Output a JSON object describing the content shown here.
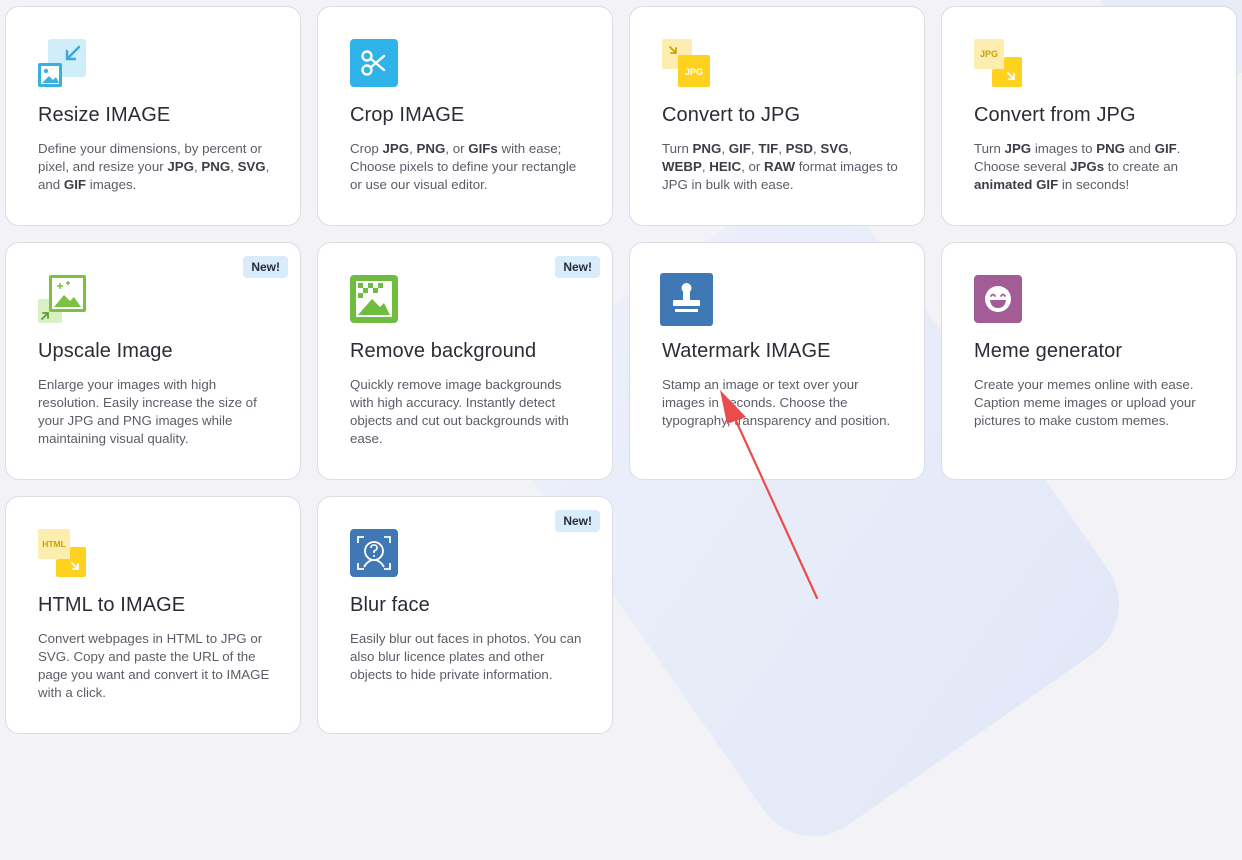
{
  "cards": [
    {
      "title": "Resize IMAGE",
      "icon": "resize-icon",
      "desc": [
        [
          "Define your dimensions, by percent or pixel, and resize your ",
          false
        ],
        [
          "JPG",
          true
        ],
        [
          ", ",
          false
        ],
        [
          "PNG",
          true
        ],
        [
          ", ",
          false
        ],
        [
          "SVG",
          true
        ],
        [
          ", and ",
          false
        ],
        [
          "GIF",
          true
        ],
        [
          " images.",
          false
        ]
      ]
    },
    {
      "title": "Crop IMAGE",
      "icon": "scissors-icon",
      "desc": [
        [
          "Crop ",
          false
        ],
        [
          "JPG",
          true
        ],
        [
          ", ",
          false
        ],
        [
          "PNG",
          true
        ],
        [
          ", or ",
          false
        ],
        [
          "GIFs",
          true
        ],
        [
          " with ease; Choose pixels to define your rectangle or use our visual editor.",
          false
        ]
      ]
    },
    {
      "title": "Convert to JPG",
      "icon": "convert-to-jpg-icon",
      "icon_text": "JPG",
      "desc": [
        [
          "Turn ",
          false
        ],
        [
          "PNG",
          true
        ],
        [
          ", ",
          false
        ],
        [
          "GIF",
          true
        ],
        [
          ", ",
          false
        ],
        [
          "TIF",
          true
        ],
        [
          ", ",
          false
        ],
        [
          "PSD",
          true
        ],
        [
          ", ",
          false
        ],
        [
          "SVG",
          true
        ],
        [
          ", ",
          false
        ],
        [
          "WEBP",
          true
        ],
        [
          ", ",
          false
        ],
        [
          "HEIC",
          true
        ],
        [
          ", or ",
          false
        ],
        [
          "RAW",
          true
        ],
        [
          " format images to JPG in bulk with ease.",
          false
        ]
      ]
    },
    {
      "title": "Convert from JPG",
      "icon": "convert-from-jpg-icon",
      "icon_text": "JPG",
      "desc": [
        [
          "Turn ",
          false
        ],
        [
          "JPG",
          true
        ],
        [
          " images to ",
          false
        ],
        [
          "PNG",
          true
        ],
        [
          " and ",
          false
        ],
        [
          "GIF",
          true
        ],
        [
          ". Choose several ",
          false
        ],
        [
          "JPGs",
          true
        ],
        [
          " to create an ",
          false
        ],
        [
          "animated GIF",
          true
        ],
        [
          " in seconds!",
          false
        ]
      ]
    },
    {
      "title": "Upscale Image",
      "icon": "upscale-icon",
      "badge": "New!",
      "desc": [
        [
          "Enlarge your images with high resolution. Easily increase the size of your JPG and PNG images while maintaining visual quality.",
          false
        ]
      ]
    },
    {
      "title": "Remove background",
      "icon": "remove-background-icon",
      "badge": "New!",
      "desc": [
        [
          "Quickly remove image backgrounds with high accuracy. Instantly detect objects and cut out backgrounds with ease.",
          false
        ]
      ]
    },
    {
      "title": "Watermark IMAGE",
      "icon": "stamp-icon",
      "desc": [
        [
          "Stamp an image or text over your images in seconds. Choose the typography, transparency and position.",
          false
        ]
      ]
    },
    {
      "title": "Meme generator",
      "icon": "laughing-face-icon",
      "desc": [
        [
          "Create your memes online with ease. Caption meme images or upload your pictures to make custom memes.",
          false
        ]
      ]
    },
    {
      "title": "HTML to IMAGE",
      "icon": "html-to-image-icon",
      "icon_text": "HTML",
      "desc": [
        [
          "Convert webpages in HTML to JPG or SVG. Copy and paste the URL of the page you want and convert it to IMAGE with a click.",
          false
        ]
      ]
    },
    {
      "title": "Blur face",
      "icon": "blur-face-icon",
      "badge": "New!",
      "desc": [
        [
          "Easily blur out faces in photos. You can also blur licence plates and other objects to hide private information.",
          false
        ]
      ]
    }
  ],
  "annotation": {
    "icon": "red-arrow-pointer-icon",
    "color": "#ec4b4b"
  },
  "colors": {
    "card_border": "#dcdce3",
    "badge_bg": "#d8ecfb",
    "title": "#2c2c36",
    "desc": "#5c5c68"
  }
}
